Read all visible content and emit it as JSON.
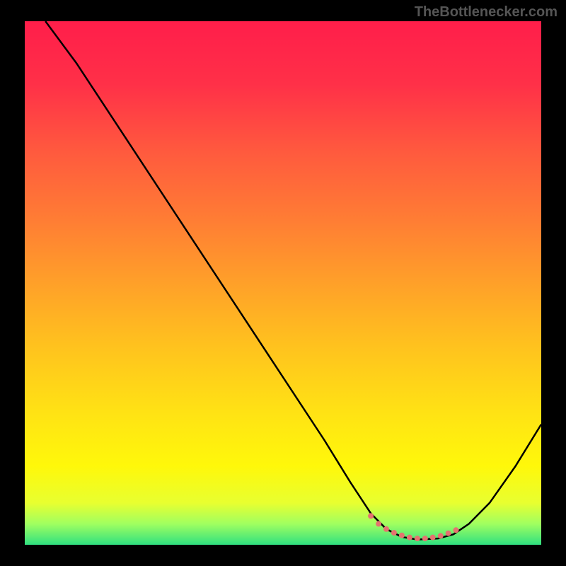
{
  "attribution": "TheBottlenecker.com",
  "chart_data": {
    "type": "line",
    "title": "",
    "xlabel": "",
    "ylabel": "",
    "xlim": [
      0,
      100
    ],
    "ylim": [
      0,
      100
    ],
    "series": [
      {
        "name": "curve",
        "points": [
          [
            4,
            100
          ],
          [
            10,
            92
          ],
          [
            20,
            77
          ],
          [
            30,
            62
          ],
          [
            40,
            47
          ],
          [
            50,
            32
          ],
          [
            58,
            20
          ],
          [
            63,
            12
          ],
          [
            67,
            6
          ],
          [
            70,
            3
          ],
          [
            73,
            1.5
          ],
          [
            76,
            1
          ],
          [
            80,
            1.2
          ],
          [
            83,
            2
          ],
          [
            86,
            4
          ],
          [
            90,
            8
          ],
          [
            95,
            15
          ],
          [
            100,
            23
          ]
        ]
      }
    ],
    "dots": [
      [
        67,
        5.5
      ],
      [
        68.5,
        4
      ],
      [
        70,
        3
      ],
      [
        71.5,
        2.3
      ],
      [
        73,
        1.8
      ],
      [
        74.5,
        1.4
      ],
      [
        76,
        1.2
      ],
      [
        77.5,
        1.2
      ],
      [
        79,
        1.4
      ],
      [
        80.5,
        1.7
      ],
      [
        82,
        2.2
      ],
      [
        83.5,
        2.8
      ]
    ],
    "gradient_stops": [
      {
        "offset": 0,
        "color": "#ff1e4a"
      },
      {
        "offset": 12,
        "color": "#ff3048"
      },
      {
        "offset": 25,
        "color": "#ff5a3e"
      },
      {
        "offset": 38,
        "color": "#ff7d34"
      },
      {
        "offset": 50,
        "color": "#ffa029"
      },
      {
        "offset": 62,
        "color": "#ffc21e"
      },
      {
        "offset": 75,
        "color": "#ffe314"
      },
      {
        "offset": 85,
        "color": "#fff80a"
      },
      {
        "offset": 92,
        "color": "#e8ff30"
      },
      {
        "offset": 96,
        "color": "#a0ff60"
      },
      {
        "offset": 100,
        "color": "#30e080"
      }
    ]
  }
}
